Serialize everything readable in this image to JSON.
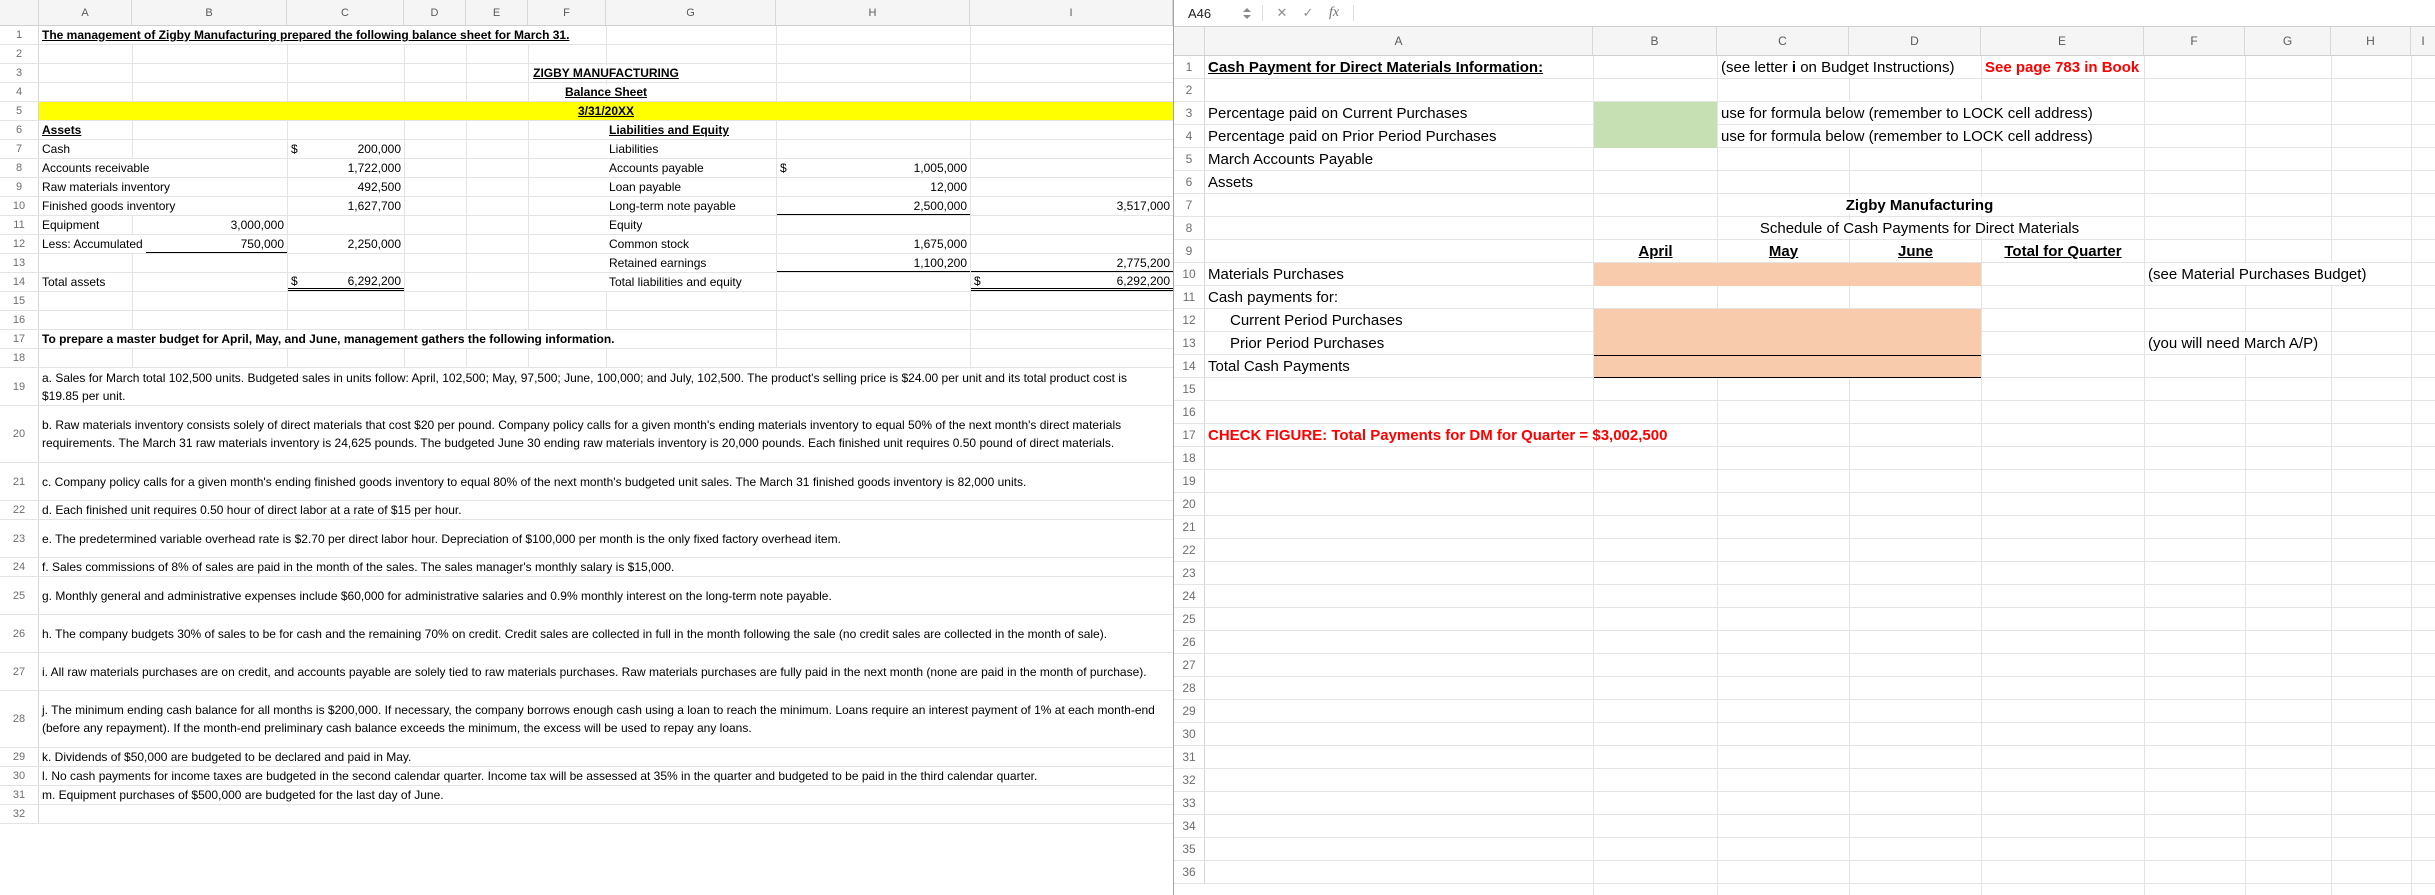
{
  "colors": {
    "yellow": "#ffff00",
    "green": "#c6e0b4",
    "orange": "#f8cbad",
    "red": "#ff0000"
  },
  "left_window": {
    "column_headers": [
      "A",
      "B",
      "C",
      "D",
      "E",
      "F",
      "G",
      "H",
      "I"
    ],
    "row_numbers": [
      "1",
      "2",
      "3",
      "4",
      "5",
      "6",
      "7",
      "8",
      "9",
      "10",
      "11",
      "12",
      "13",
      "14",
      "15",
      "16",
      "17",
      "18",
      "19",
      "20",
      "21",
      "22",
      "23",
      "24",
      "25",
      "26",
      "27",
      "28",
      "29",
      "30",
      "31",
      "32"
    ],
    "intro": "The management of Zigby Manufacturing prepared the following balance sheet for March 31.",
    "balance_sheet": {
      "company": "ZIGBY MANUFACTURING",
      "statement": "Balance Sheet",
      "date": "3/31/20XX",
      "assets_header": "Assets",
      "liabilities_equity_header": "Liabilities and Equity",
      "dollar": "$",
      "cash_label": "Cash",
      "cash": "200,000",
      "ar_label": "Accounts receivable",
      "ar": "1,722,000",
      "rm_label": "Raw materials inventory",
      "rm": "492,500",
      "fg_label": "Finished goods inventory",
      "fg": "1,627,700",
      "equipment_label": "Equipment",
      "equipment": "3,000,000",
      "less_accum_label": "Less: Accumulated",
      "accum_depr": "750,000",
      "equipment_net": "2,250,000",
      "total_assets_label": "Total assets",
      "total_assets": "6,292,200",
      "liabilities_label": "Liabilities",
      "ap_label": "Accounts payable",
      "ap": "1,005,000",
      "loan_label": "Loan payable",
      "loan": "12,000",
      "ltnote_label": "Long-term note payable",
      "ltnote": "2,500,000",
      "total_liabilities": "3,517,000",
      "equity_label": "Equity",
      "cs_label": "Common stock",
      "cs": "1,675,000",
      "re_label": "Retained earnings",
      "re": "1,100,200",
      "total_equity": "2,775,200",
      "tle_label": "Total liabilities and equity",
      "tle": "6,292,200"
    },
    "budget_intro": "To prepare a master budget for April, May, and June, management gathers the following information.",
    "notes": {
      "a": "a. Sales for March total 102,500 units. Budgeted sales in units follow: April, 102,500; May, 97,500; June, 100,000; and July, 102,500. The product's selling price is $24.00 per unit and its total product cost is $19.85 per unit.",
      "b": "b. Raw materials inventory consists solely of direct materials that cost $20 per pound. Company policy calls for a given month's ending materials inventory to equal 50% of the next month's direct materials requirements. The March 31 raw materials inventory is 24,625 pounds. The budgeted June 30 ending raw materials inventory is 20,000 pounds. Each finished unit requires 0.50 pound of direct materials.",
      "c": "c. Company policy calls for a given month's ending finished goods inventory to equal 80% of the next month's budgeted unit sales. The March 31 finished goods inventory is 82,000 units.",
      "d": "d. Each finished unit requires 0.50 hour of direct labor at a rate of $15 per hour.",
      "e": "e. The predetermined variable overhead rate is $2.70 per direct labor hour. Depreciation of $100,000 per month is the only fixed factory overhead item.",
      "f": "f. Sales commissions of 8% of sales are paid in the month of the sales. The sales manager's monthly salary is $15,000.",
      "g": "g. Monthly general and administrative expenses include $60,000 for administrative salaries and 0.9% monthly interest on the long-term note payable.",
      "h": "h. The company budgets 30% of sales to be for cash and the remaining 70% on credit. Credit sales are collected in full in the month following the sale (no credit sales are collected in the month of sale).",
      "i": "i. All raw materials purchases are on credit, and accounts payable are solely tied to raw materials purchases. Raw materials purchases are fully paid in the next month (none are paid in the month of purchase).",
      "j": "j. The minimum ending cash balance for all months is $200,000. If necessary, the company borrows enough cash using a loan to reach the minimum. Loans require an interest payment of 1% at each month-end (before any repayment). If the month-end preliminary cash balance exceeds the minimum, the excess will be used to repay any loans.",
      "k": "k. Dividends of $50,000 are budgeted to be declared and paid in May.",
      "l": "l. No cash payments for income taxes are budgeted in the second calendar quarter. Income tax will be assessed at 35% in the quarter and budgeted to be paid in the third calendar quarter.",
      "m": "m. Equipment purchases of $500,000 are budgeted for the last day of June."
    }
  },
  "right_window": {
    "formula_bar": {
      "name_box": "A46",
      "cancel": "✕",
      "enter": "✓",
      "fx": "fx"
    },
    "column_headers": [
      "A",
      "B",
      "C",
      "D",
      "E",
      "F",
      "G",
      "H",
      "I"
    ],
    "row_numbers": [
      "1",
      "2",
      "3",
      "4",
      "5",
      "6",
      "7",
      "8",
      "9",
      "10",
      "11",
      "12",
      "13",
      "14",
      "15",
      "16",
      "17",
      "18",
      "19",
      "20",
      "21",
      "22",
      "23",
      "24",
      "25",
      "26",
      "27",
      "28",
      "29",
      "30",
      "31",
      "32",
      "33",
      "34",
      "35",
      "36"
    ],
    "cells": {
      "title": "Cash Payment for Direct Materials Information:",
      "see_letter_p1": "(see letter ",
      "see_letter_i": "i",
      "see_letter_p3": " on Budget Instructions)",
      "see_page": "See page 783 in Book",
      "pct_current_label": "Percentage paid on Current Purchases",
      "pct_prior_label": "Percentage paid on Prior Period Purchases",
      "lock_note": "use for formula below (remember to LOCK cell address)",
      "march_ap_label": "March Accounts Payable",
      "assets_label": "Assets",
      "company": "Zigby Manufacturing",
      "schedule_title": "Schedule of Cash Payments for Direct Materials",
      "april": "April",
      "may": "May",
      "june": "June",
      "total_quarter": "Total for Quarter",
      "materials_purchases_label": "Materials Purchases",
      "see_material_note": "(see Material Purchases Budget)",
      "cash_payments_label": "Cash payments for:",
      "current_period_label": "Current Period Purchases",
      "prior_period_label": "Prior Period Purchases",
      "march_ap_note": "(you will need March A/P)",
      "total_cash_label": "Total Cash Payments",
      "check_figure": "CHECK FIGURE: Total Payments for DM for Quarter = $3,002,500"
    }
  }
}
